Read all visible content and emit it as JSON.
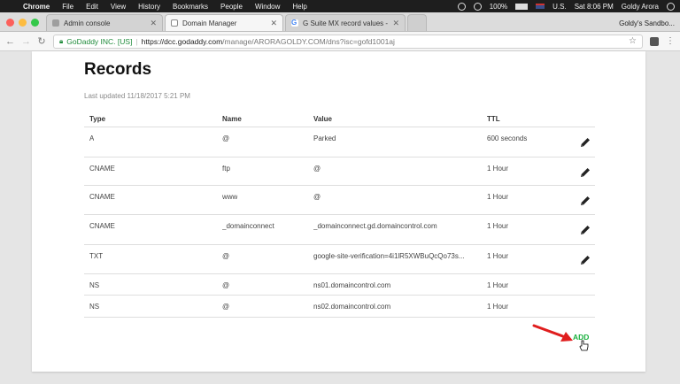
{
  "menubar": {
    "app_name": "Chrome",
    "items": [
      "File",
      "Edit",
      "View",
      "History",
      "Bookmarks",
      "People",
      "Window",
      "Help"
    ],
    "battery": "100%",
    "locale": "U.S.",
    "clock": "Sat 8:06 PM",
    "user": "Goldy Arora"
  },
  "tabs": [
    {
      "label": "Admin console",
      "active": false
    },
    {
      "label": "Domain Manager",
      "active": true
    },
    {
      "label": "G Suite MX record values - G",
      "active": false
    }
  ],
  "profile_label": "Goldy's Sandbo...",
  "address": {
    "secure_label": "GoDaddy INC. [US]",
    "host": "https://dcc.godaddy.com",
    "path": "/manage/ARORAGOLDY.COM/dns?isc=gofd1001aj"
  },
  "records": {
    "title": "Records",
    "last_updated": "Last updated 11/18/2017 5:21 PM",
    "columns": {
      "type": "Type",
      "name": "Name",
      "value": "Value",
      "ttl": "TTL"
    },
    "rows": [
      {
        "type": "A",
        "name": "@",
        "value": "Parked",
        "ttl": "600 seconds",
        "editable": true
      },
      {
        "type": "CNAME",
        "name": "ftp",
        "value": "@",
        "ttl": "1 Hour",
        "editable": true
      },
      {
        "type": "CNAME",
        "name": "www",
        "value": "@",
        "ttl": "1 Hour",
        "editable": true
      },
      {
        "type": "CNAME",
        "name": "_domainconnect",
        "value": "_domainconnect.gd.domaincontrol.com",
        "ttl": "1 Hour",
        "editable": true
      },
      {
        "type": "TXT",
        "name": "@",
        "value": "google-site-verification=4i1lR5XWBuQcQo73s...",
        "ttl": "1 Hour",
        "editable": true
      },
      {
        "type": "NS",
        "name": "@",
        "value": "ns01.domaincontrol.com",
        "ttl": "1 Hour",
        "editable": false
      },
      {
        "type": "NS",
        "name": "@",
        "value": "ns02.domaincontrol.com",
        "ttl": "1 Hour",
        "editable": false
      }
    ],
    "add_label": "ADD"
  },
  "colors": {
    "add_green": "#1bb13f",
    "arrow_red": "#e01e1e"
  },
  "icons": [
    "apple-icon",
    "back-icon",
    "forward-icon",
    "reload-icon",
    "lock-icon",
    "star-icon",
    "pencil-icon",
    "close-icon",
    "arrow-icon",
    "hand-cursor-icon"
  ]
}
